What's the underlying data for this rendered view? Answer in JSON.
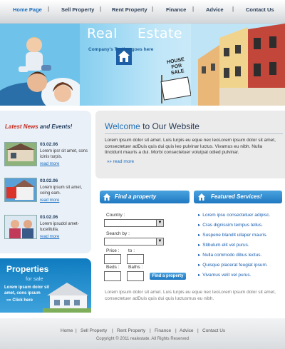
{
  "nav": {
    "items": [
      "Home Page",
      "Sell Property",
      "Rent Property",
      "Finance",
      "Advice",
      "Contact Us"
    ],
    "separator": "|"
  },
  "hero": {
    "logo_word1": "Real",
    "logo_word2": "Estate",
    "tagline": "Company's Tagline goes here",
    "sign_line1": "HOUSE",
    "sign_line2": "FOR SALE"
  },
  "news": {
    "title_part1": "Latest News",
    "title_part2": " and Events!",
    "items": [
      {
        "date": "03.02.06",
        "text": "Lorem ipsr sit amet, cons icinis turpis.",
        "more": "read more"
      },
      {
        "date": "03.02.06",
        "text": "Lorem ipsum sit amet, coing eam.",
        "more": "read more"
      },
      {
        "date": "03.02.06",
        "text": "Lorem ipsudol amet- tucelitulla.",
        "more": "read more"
      }
    ]
  },
  "properties": {
    "title": "Properties",
    "subtitle": "for sale",
    "text": "Lorem ipsum dolor sit amet, cons ipsum",
    "click": "»» Click here"
  },
  "welcome": {
    "title_part1": "Welcome",
    "title_part2": " to Our Website",
    "text": "Lorem ipsum dolor sit amet. Luis turpis eu eque nec leoLorem ipsum dolor sit amet, consectetuer adDuis quis dui quis leo pulvinar luctus. Vivamus eu nibh. Nulla tincidunt mauris a dui. Morbi consectetuer volutpat odied pulvinar.",
    "more": "read more"
  },
  "find": {
    "title": "Find a property",
    "country_label": "Country :",
    "search_label": "Search by :",
    "price_label": "Price :",
    "to_label": "to :",
    "beds_label": "Beds :",
    "baths_label": "Baths :",
    "button": "Find a property"
  },
  "services": {
    "title": "Featured Services!",
    "items": [
      "Lorem ipsu consectetuer adipisc.",
      "Cras dignissim tempus tellus.",
      "Suspene blandit ullaper mauris.",
      "Stibulum elit vel purus.",
      "Nulla commodo dibus lectus.",
      "Quisque placerat feugiat ipsum.",
      "Vivamus velit vel purus."
    ]
  },
  "bottom_text": "Lorem ipsum dolor sit amet. Luis turpis eu eque nec leoLorem ipsum dolor sit amet, consectetuer adDuis quis dui quis luctusmus eu nibh.",
  "footer": {
    "items": [
      "Home",
      "Sell Property",
      "Rent Property",
      "Finance",
      "Advice",
      "Contact Us"
    ],
    "separator": "|",
    "copyright": "Copyright © 2011 realestate. All Rights Reserved"
  },
  "colors": {
    "nav_active": "#1a6fbf",
    "news_title": "#c22b1f",
    "accent_blue": "#1f78c0",
    "link_blue": "#1a5fb0"
  }
}
